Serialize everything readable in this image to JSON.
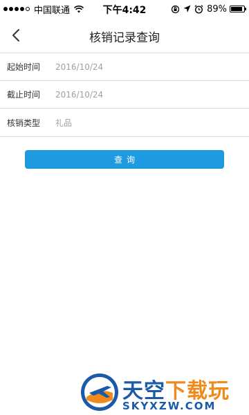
{
  "status_bar": {
    "carrier": "中国联通",
    "time": "下午4:42",
    "battery_text": "89%",
    "battery_level": 0.89,
    "icons": [
      "signal-icon",
      "wifi-icon",
      "rotation-lock-icon",
      "location-icon",
      "alarm-icon",
      "battery-icon"
    ]
  },
  "nav": {
    "title": "核销记录查询",
    "back_icon": "chevron-left-icon"
  },
  "form": {
    "rows": [
      {
        "label": "起始时间",
        "value": "2016/10/24"
      },
      {
        "label": "截止时间",
        "value": "2016/10/24"
      },
      {
        "label": "核销类型",
        "value": "礼品"
      }
    ]
  },
  "query_button": {
    "label": "查询"
  },
  "watermark": {
    "title_part1": "天空",
    "title_part2": "下载玩",
    "subtitle": "SKYXZW.COM",
    "colors": {
      "blue": "#1a5aa8",
      "orange": "#f08a1c"
    }
  },
  "colors": {
    "accent": "#1e9be0",
    "value_text": "#a0a0a0",
    "divider": "#dcdcdc"
  }
}
